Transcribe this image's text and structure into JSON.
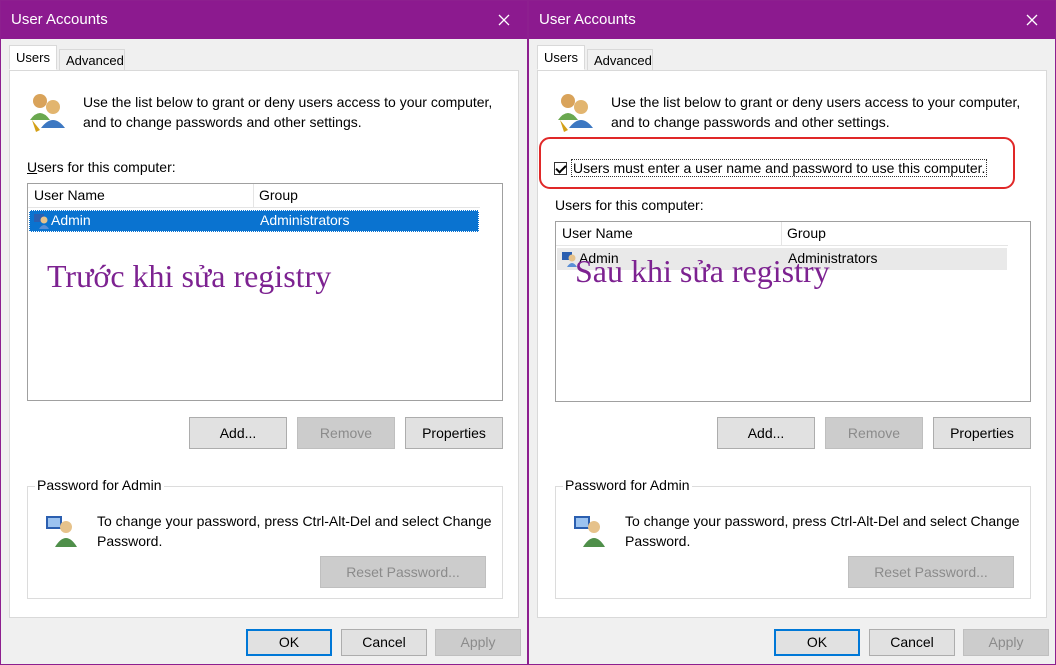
{
  "left_window": {
    "title": "User Accounts",
    "tabs": [
      {
        "label": "Users"
      },
      {
        "label": "Advanced"
      }
    ],
    "intro": "Use the list below to grant or deny users access to your computer, and to change passwords and other settings.",
    "users_label": "Users for this computer:",
    "columns": [
      "User Name",
      "Group"
    ],
    "rows": [
      {
        "name": "Admin",
        "group": "Administrators"
      }
    ],
    "overlay": "Trước khi sửa registry",
    "buttons": {
      "add": "Add...",
      "remove": "Remove",
      "properties": "Properties"
    },
    "password_group": "Password for Admin",
    "password_text": "To change your password, press Ctrl-Alt-Del and select Change Password.",
    "reset_password": "Reset Password...",
    "footer": {
      "ok": "OK",
      "cancel": "Cancel",
      "apply": "Apply"
    }
  },
  "right_window": {
    "title": "User Accounts",
    "tabs": [
      {
        "label": "Users"
      },
      {
        "label": "Advanced"
      }
    ],
    "intro": "Use the list below to grant or deny users access to your computer, and to change passwords and other settings.",
    "checkbox_label": "Users must enter a user name and password to use this computer.",
    "checkbox_checked": true,
    "users_label": "Users for this computer:",
    "columns": [
      "User Name",
      "Group"
    ],
    "rows": [
      {
        "name": "Admin",
        "group": "Administrators"
      }
    ],
    "overlay": "Sau khi sửa registry",
    "buttons": {
      "add": "Add...",
      "remove": "Remove",
      "properties": "Properties"
    },
    "password_group": "Password for Admin",
    "password_text": "To change your password, press Ctrl-Alt-Del and select Change Password.",
    "reset_password": "Reset Password...",
    "footer": {
      "ok": "OK",
      "cancel": "Cancel",
      "apply": "Apply"
    }
  },
  "colors": {
    "titlebar": "#8c1a8f",
    "overlay_text": "#7d2291",
    "selection": "#0a73d0",
    "highlight_box": "#e02828"
  },
  "icons": [
    "close-icon",
    "users-icon",
    "user-icon",
    "password-user-icon",
    "checkbox-checked-icon"
  ]
}
